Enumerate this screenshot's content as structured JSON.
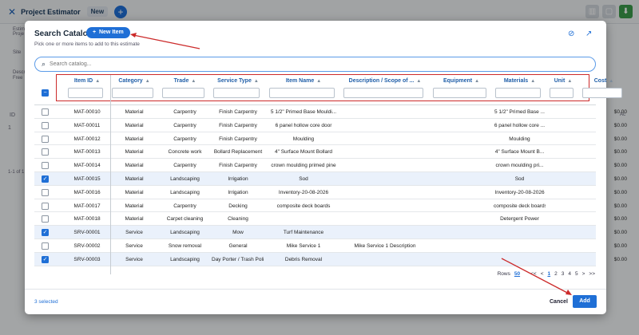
{
  "app": {
    "title": "Project Estimator",
    "badge": "New"
  },
  "background": {
    "estimate_label": "Estimat",
    "project_label": "Proje",
    "site_label": "Site",
    "descr_label": "Descri",
    "free_label": "Free",
    "id_header": "ID",
    "row_id": "1",
    "pager": "1-1 of 1",
    "ac_header": "Ac"
  },
  "modal": {
    "title": "Search Catalog",
    "new_item_label": "New Item",
    "subtitle": "Pick one or more items to add to this estimate",
    "search_placeholder": "Search catalog...",
    "columns": [
      "Item ID",
      "Category",
      "Trade",
      "Service Type",
      "Item Name",
      "Description / Scope of ...",
      "Equipment",
      "Materials",
      "Unit",
      "Cost"
    ],
    "rows": [
      {
        "id": "MAT-00010",
        "category": "Material",
        "trade": "Carpentry",
        "service": "Finish Carpentry",
        "name": "5 1/2\" Primed Base Mouldi...",
        "desc": "",
        "equipment": "",
        "materials": "5 1/2\" Primed Base ...",
        "unit": "",
        "cost": "$0.00",
        "checked": false
      },
      {
        "id": "MAT-00011",
        "category": "Material",
        "trade": "Carpentry",
        "service": "Finish Carpentry",
        "name": "6 panel hollow core door",
        "desc": "",
        "equipment": "",
        "materials": "6 panel hollow core ...",
        "unit": "",
        "cost": "$0.00",
        "checked": false
      },
      {
        "id": "MAT-00012",
        "category": "Material",
        "trade": "Carpentry",
        "service": "Finish Carpentry",
        "name": "Moulding",
        "desc": "",
        "equipment": "",
        "materials": "Moulding",
        "unit": "",
        "cost": "$0.00",
        "checked": false
      },
      {
        "id": "MAT-00013",
        "category": "Material",
        "trade": "Concrete work",
        "service": "Bollard Replacement",
        "name": "4\" Surface Mount Bollard",
        "desc": "",
        "equipment": "",
        "materials": "4\" Surface Mount B...",
        "unit": "",
        "cost": "$0.00",
        "checked": false
      },
      {
        "id": "MAT-00014",
        "category": "Material",
        "trade": "Carpentry",
        "service": "Finish Carpentry",
        "name": "crown moulding primed pine",
        "desc": "",
        "equipment": "",
        "materials": "crown moulding pri...",
        "unit": "",
        "cost": "$0.00",
        "checked": false
      },
      {
        "id": "MAT-00015",
        "category": "Material",
        "trade": "Landscaping",
        "service": "Irrigation",
        "name": "Sod",
        "desc": "",
        "equipment": "",
        "materials": "Sod",
        "unit": "",
        "cost": "$0.00",
        "checked": true
      },
      {
        "id": "MAT-00016",
        "category": "Material",
        "trade": "Landscaping",
        "service": "Irrigation",
        "name": "Inventory-20-08-2026",
        "desc": "",
        "equipment": "",
        "materials": "Inventory-20-08-2026",
        "unit": "",
        "cost": "$0.00",
        "checked": false
      },
      {
        "id": "MAT-00017",
        "category": "Material",
        "trade": "Carpentry",
        "service": "Decking",
        "name": "composite deck boards",
        "desc": "",
        "equipment": "",
        "materials": "composite deck boards",
        "unit": "",
        "cost": "$0.00",
        "checked": false
      },
      {
        "id": "MAT-00018",
        "category": "Material",
        "trade": "Carpet cleaning",
        "service": "Cleaning",
        "name": "",
        "desc": "",
        "equipment": "",
        "materials": "Detergent Power",
        "unit": "",
        "cost": "$0.00",
        "checked": false
      },
      {
        "id": "SRV-00001",
        "category": "Service",
        "trade": "Landscaping",
        "service": "Mow",
        "name": "Turf Maintenance",
        "desc": "",
        "equipment": "",
        "materials": "",
        "unit": "",
        "cost": "$0.00",
        "checked": true
      },
      {
        "id": "SRV-00002",
        "category": "Service",
        "trade": "Snow removal",
        "service": "General",
        "name": "Mike Service 1",
        "desc": "Mike Service 1 Description",
        "equipment": "",
        "materials": "",
        "unit": "",
        "cost": "$0.00",
        "checked": false
      },
      {
        "id": "SRV-00003",
        "category": "Service",
        "trade": "Landscaping",
        "service": "Day Porter / Trash Poli...",
        "name": "Debris Removal",
        "desc": "",
        "equipment": "",
        "materials": "",
        "unit": "",
        "cost": "$0.00",
        "checked": true
      }
    ],
    "pager": {
      "rows_label": "Rows",
      "rows_value": "50",
      "first": "<<",
      "prev": "<",
      "pages": [
        "1",
        "2",
        "3",
        "4",
        "5"
      ],
      "next": ">",
      "last": ">>"
    },
    "selected_text": "3 selected",
    "cancel_label": "Cancel",
    "add_label": "Add"
  },
  "colors": {
    "accent": "#1f6fd6",
    "annotation": "#cc2b2b"
  }
}
